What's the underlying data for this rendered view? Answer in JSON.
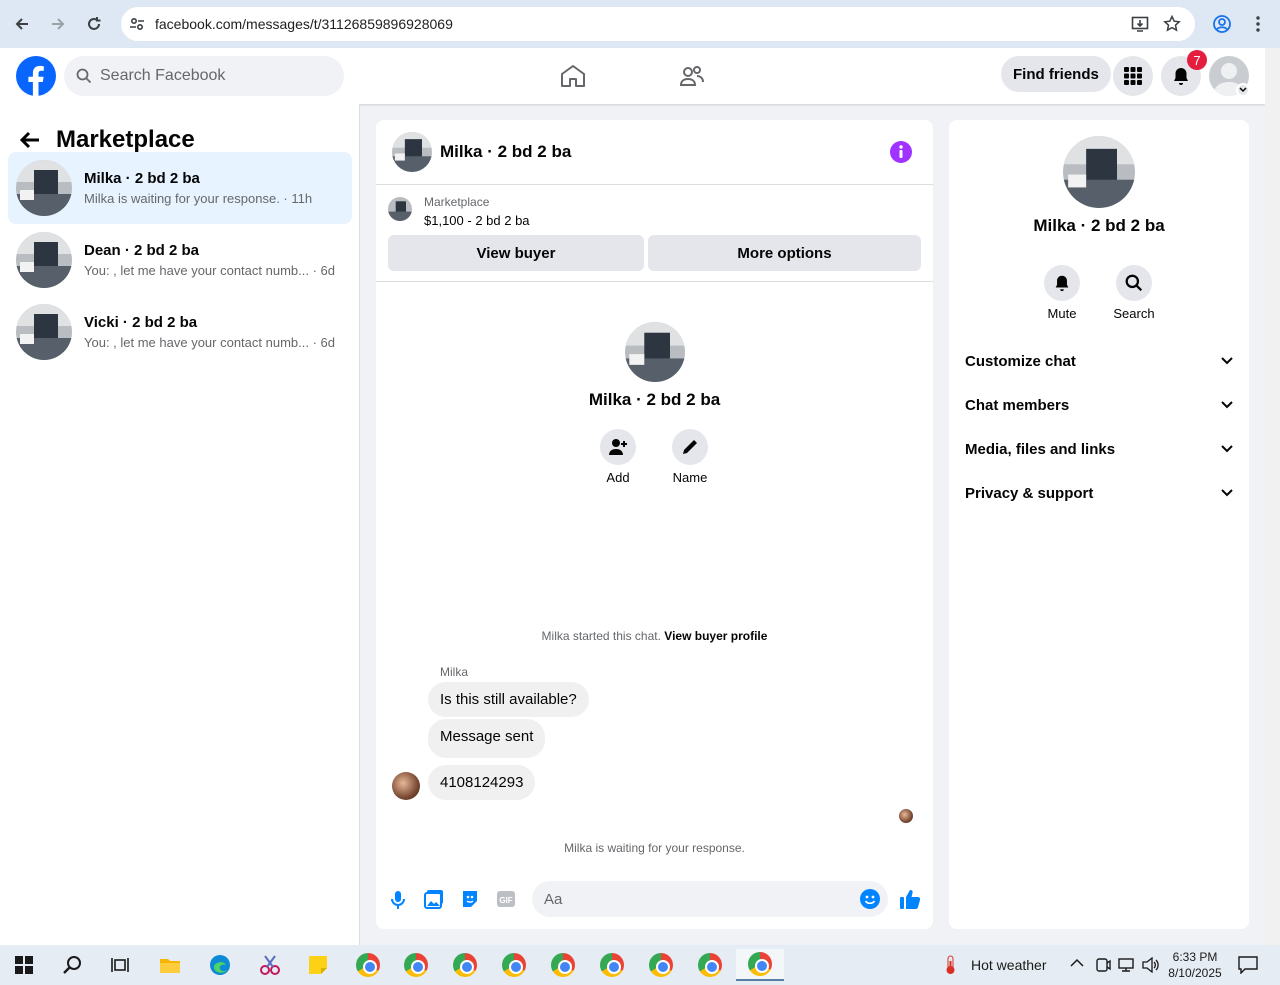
{
  "browser": {
    "url": "facebook.com/messages/t/31126859896928069"
  },
  "fb": {
    "search_placeholder": "Search Facebook",
    "find_friends": "Find friends",
    "notif_count": "7"
  },
  "left": {
    "title": "Marketplace",
    "conversations": [
      {
        "name": "Milka · 2 bd 2 ba",
        "preview": "Milka is waiting for your response. · 11h"
      },
      {
        "name": "Dean · 2 bd 2 ba",
        "preview": "You: , let me have your contact numb... · 6d"
      },
      {
        "name": "Vicki · 2 bd 2 ba",
        "preview": "You: , let me have your contact numb... · 6d"
      }
    ]
  },
  "chat": {
    "title": "Milka · 2 bd 2 ba",
    "listing_label": "Marketplace",
    "listing_detail": "$1,100 - 2 bd 2 ba",
    "view_buyer": "View buyer",
    "more_options": "More options",
    "profile_name": "Milka · 2 bd 2 ba",
    "add": "Add",
    "name": "Name",
    "started": "Milka started this chat.",
    "view_buyer_profile": "View buyer profile",
    "sender": "Milka",
    "messages": [
      "Is this still available?",
      "Message sent",
      "4108124293"
    ],
    "waiting": "Milka is waiting for your response.",
    "input_placeholder": "Aa"
  },
  "info": {
    "name": "Milka · 2 bd 2 ba",
    "mute": "Mute",
    "search": "Search",
    "sections": [
      "Customize chat",
      "Chat members",
      "Media, files and links",
      "Privacy & support"
    ]
  },
  "taskbar": {
    "weather": "Hot weather",
    "time": "6:33 PM",
    "date": "8/10/2025"
  },
  "colors": {
    "brand": "#0866ff",
    "accent": "#0084ff",
    "info": "#a033ff"
  }
}
